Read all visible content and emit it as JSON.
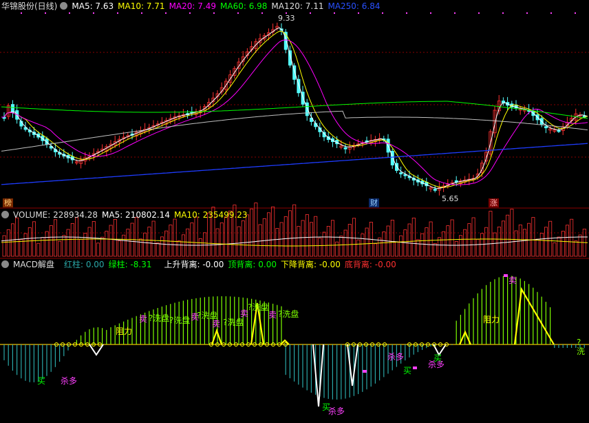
{
  "price": {
    "title": "华锦股份(日线)",
    "ma5": "MA5: 7.63",
    "ma10": "MA10: 7.71",
    "ma20": "MA20: 7.49",
    "ma60": "MA60: 6.98",
    "ma120": "MA120: 7.11",
    "ma250": "MA250: 6.84",
    "high_label": "9.33",
    "low_label": "5.65",
    "event_tags": [
      "榜",
      "财",
      "涨"
    ]
  },
  "volume": {
    "title": "VOLUME: 228934.28",
    "ma5": "MA5: 210802.14",
    "ma10": "MA10: 235499.23"
  },
  "macd": {
    "title": "MACD解盘",
    "red": "红柱: 0.00",
    "green": "绿柱: -8.31",
    "up_div": "上升背离: -0.00",
    "top_div": "顶背离: 0.00",
    "down_div": "下降背离: -0.00",
    "bottom_div": "底背离: -0.00",
    "signal_labels": [
      "卖",
      "?洗盘",
      "?洗盘",
      "卖",
      "?洗盘",
      "卖",
      "?洗盘",
      "卖",
      "?洗盘",
      "卖",
      "?洗盘",
      "阻力",
      "阻力",
      "卖",
      "买",
      "杀多",
      "杀多",
      "买",
      "杀多",
      "买",
      "杀多",
      "买",
      "?洗"
    ]
  },
  "colors": {
    "up": "#ff3232",
    "down": "#54ffff",
    "ma5": "#ffffff",
    "ma10": "#ffff00",
    "ma20": "#ff00ff",
    "ma60": "#00ff00",
    "ma120": "#c0c0c0",
    "ma250": "#1e3cff",
    "grid": "#8b0000",
    "sell": "#ff40ff",
    "wash": "#7fff00",
    "resist": "#ffff00",
    "buy": "#00ff00"
  }
}
